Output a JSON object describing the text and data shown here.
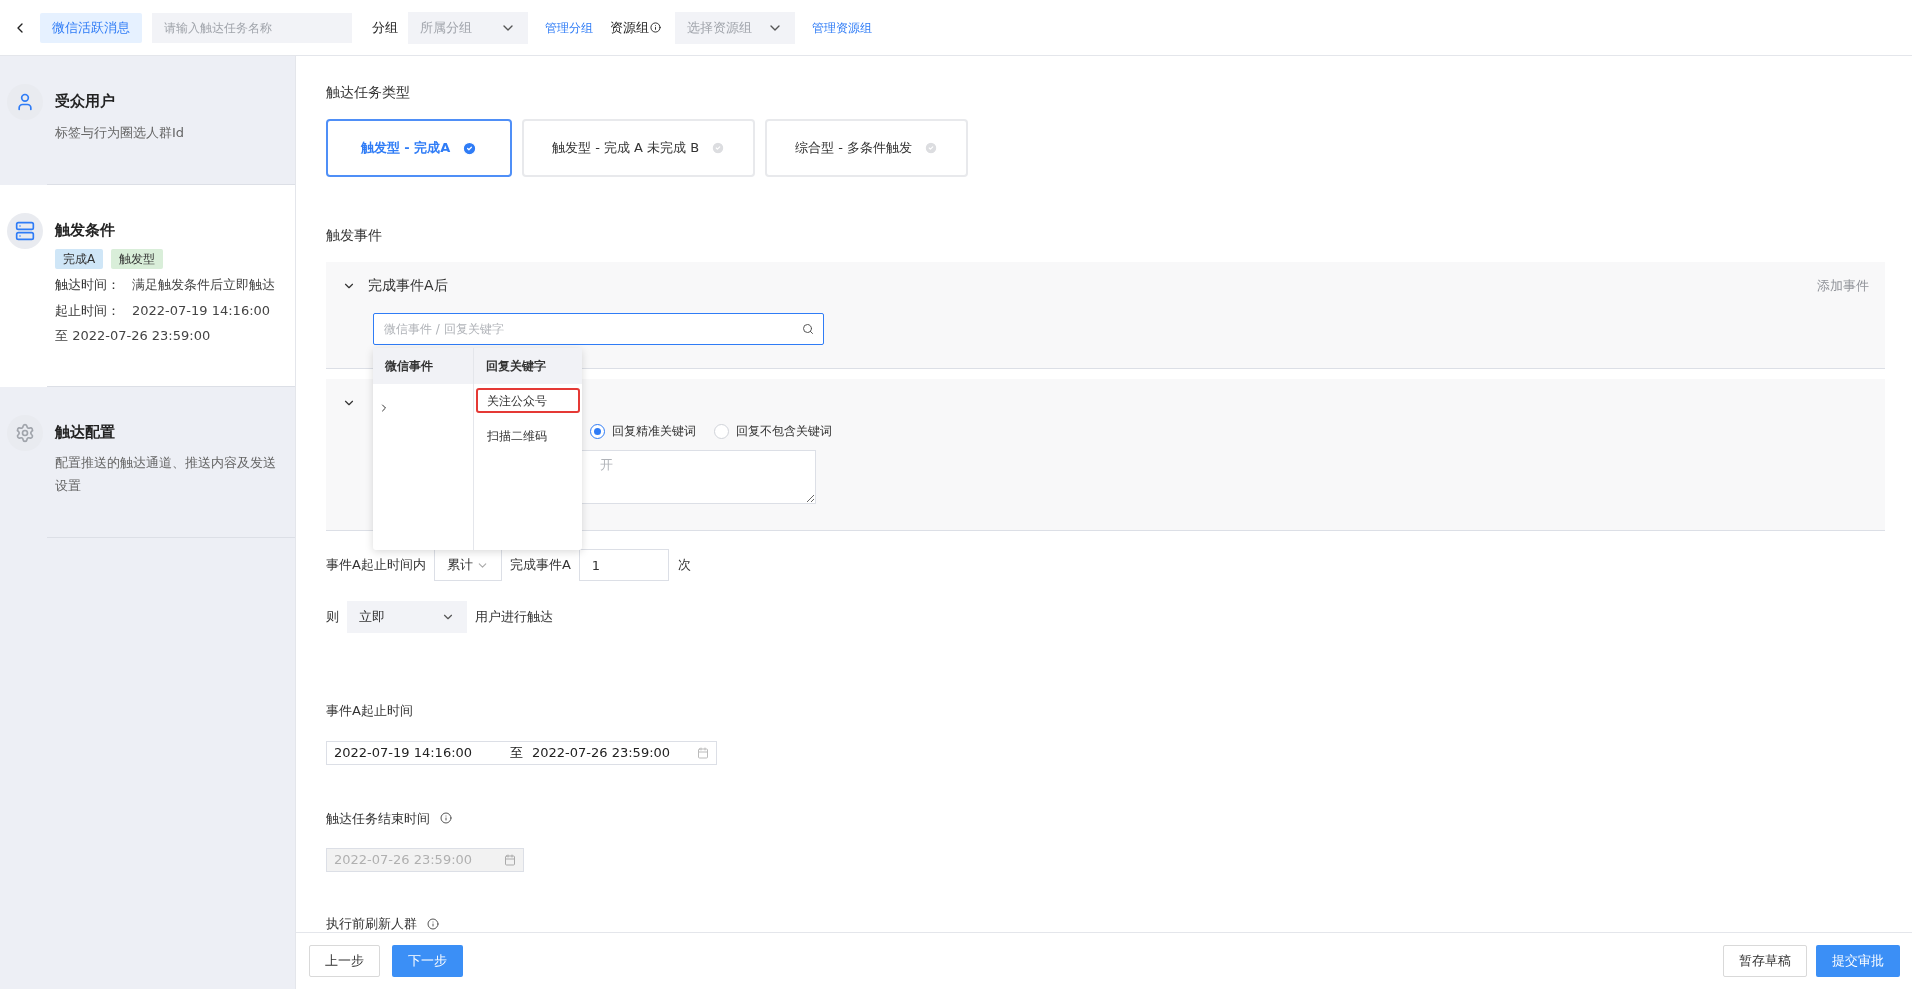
{
  "header": {
    "title_tag": "微信活跃消息",
    "name_field": {
      "placeholder": "请输入触达任务名称"
    },
    "group_label": "分组",
    "group_select": {
      "placeholder": "所属分组"
    },
    "manage_group_link": "管理分组",
    "resource_label": "资源组",
    "resource_select": {
      "placeholder": "选择资源组"
    },
    "manage_resource_link": "管理资源组"
  },
  "steps": [
    {
      "title": "受众用户",
      "kind": "audience",
      "done": true,
      "selected": false,
      "description": "标签与行为圈选人群Id"
    },
    {
      "title": "触发条件",
      "kind": "trigger",
      "done": true,
      "selected": true,
      "tags": [
        {
          "text": "完成A",
          "color": "#cfe6f7"
        },
        {
          "text": "触发型",
          "color": "#d9eed9"
        }
      ],
      "details": [
        {
          "label": "触达时间：",
          "value": "满足触发条件后立即触达"
        },
        {
          "label": "起止时间：",
          "value": "2022-07-19 14:16:00"
        },
        {
          "value": "至 2022-07-26 23:59:00"
        }
      ]
    },
    {
      "title": "触达配置",
      "kind": "delivery",
      "done": false,
      "selected": false,
      "description": "配置推送的触达通道、推送内容及发送设置"
    }
  ],
  "task_type": {
    "label": "触达任务类型",
    "options": [
      {
        "label": "触发型 - 完成A",
        "selected": true
      },
      {
        "label": "触发型 - 完成 A 未完成 B",
        "selected": false
      },
      {
        "label": "综合型 - 多条件触发",
        "selected": false
      }
    ]
  },
  "trigger_events": {
    "label": "触发事件",
    "add_event_link": "添加事件",
    "first_panel": {
      "title": "完成事件A后",
      "expanded": true,
      "search_field": {
        "placeholder": "微信事件 / 回复关键字"
      }
    },
    "second_panel": {
      "expanded": true,
      "radios": [
        {
          "label": "回复精准关键词",
          "selected": true
        },
        {
          "label": "回复不包含关键词",
          "selected": false
        }
      ],
      "keyword_area": {
        "placeholder": "开"
      }
    },
    "dropdown": {
      "columns": [
        {
          "header": "微信事件",
          "selected": true
        },
        {
          "header": "回复关键字",
          "selected": true,
          "items": [
            {
              "label": "关注公众号",
              "selected": true
            },
            {
              "label": "扫描二维码",
              "selected": false
            }
          ]
        }
      ]
    }
  },
  "count_row": {
    "prefix": "事件A起止时间内",
    "mode": "累计",
    "middle": "完成事件A",
    "count": "1",
    "suffix": "次"
  },
  "then_row": {
    "prefix": "则",
    "timing": "立即",
    "suffix": "用户进行触达"
  },
  "event_period": {
    "label": "事件A起止时间",
    "start": "2022-07-19 14:16:00",
    "separator": "至",
    "end": "2022-07-26 23:59:00"
  },
  "end_time": {
    "label": "触达任务结束时间",
    "value": "2022-07-26 23:59:00",
    "disabled": true
  },
  "refresh": {
    "label": "执行前刷新人群"
  },
  "footer": {
    "prev": "上一步",
    "next": "下一步",
    "draft": "暂存草稿",
    "submit": "提交审批"
  }
}
